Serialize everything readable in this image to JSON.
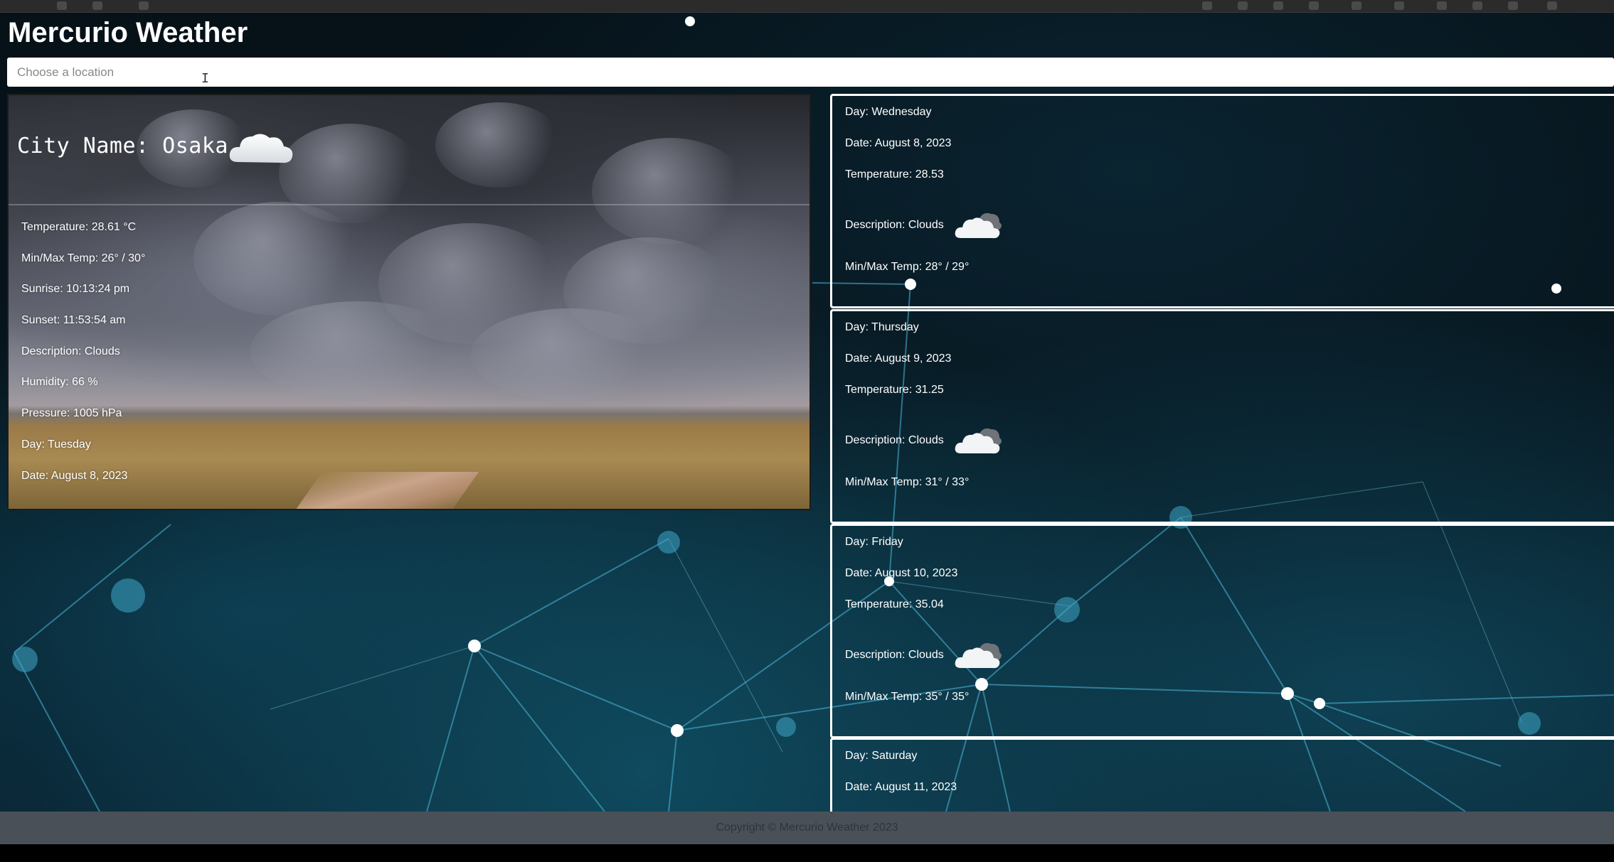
{
  "app": {
    "title": "Mercurio Weather"
  },
  "search": {
    "placeholder": "Choose a location",
    "value": ""
  },
  "current": {
    "city_label": "City Name: Osaka",
    "icon": "cloud-icon",
    "details": [
      "Temperature: 28.61 °C",
      "Min/Max Temp: 26° / 30°",
      "Sunrise: 10:13:24 pm",
      "Sunset: 11:53:54 am",
      "Description: Clouds",
      "Humidity: 66 %",
      "Pressure: 1005 hPa",
      "Day: Tuesday",
      "Date: August 8, 2023"
    ]
  },
  "forecast": [
    {
      "day": "Day: Wednesday",
      "date": "Date: August 8, 2023",
      "temperature": "Temperature: 28.53",
      "description": "Description: Clouds",
      "minmax": "Min/Max Temp: 28° / 29°",
      "icon": "cloud-icon"
    },
    {
      "day": "Day: Thursday",
      "date": "Date: August 9, 2023",
      "temperature": "Temperature: 31.25",
      "description": "Description: Clouds",
      "minmax": "Min/Max Temp: 31° / 33°",
      "icon": "cloud-icon"
    },
    {
      "day": "Day: Friday",
      "date": "Date: August 10, 2023",
      "temperature": "Temperature: 35.04",
      "description": "Description: Clouds",
      "minmax": "Min/Max Temp: 35° / 35°",
      "icon": "cloud-icon"
    },
    {
      "day": "Day: Saturday",
      "date": "Date: August 11, 2023"
    }
  ],
  "footer": {
    "copyright": "Copyright © Mercurio Weather 2023"
  },
  "colors": {
    "card_border": "#ffffff",
    "footer_bg": "#4a5058",
    "background": "#061118"
  }
}
